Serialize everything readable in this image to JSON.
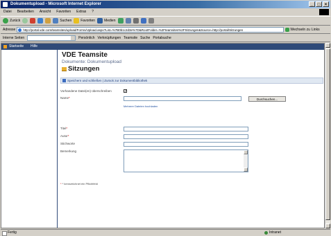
{
  "window": {
    "title": "Dokumentupload - Microsoft Internet Explorer",
    "controls": [
      "_",
      "□",
      "×"
    ]
  },
  "menubar": [
    "Datei",
    "Bearbeiten",
    "Ansicht",
    "Favoriten",
    "Extras",
    "?"
  ],
  "toolbar": {
    "back": "Zurück",
    "forward": "",
    "search": "Suchen",
    "favorites": "Favoriten",
    "media": "Medien"
  },
  "addressbar": {
    "label": "Adresse",
    "url": "http://portal.vde.com/teamsites/upload/Forms/Upload.aspx?List=%7B0b1c2d3e%7D&RootFolder=%2Fteamsites%2FSitzungen&Source=http://portal/Sitzungen",
    "go": "Wechseln zu",
    "links": "Links"
  },
  "linksbar": {
    "label": "Interne Seiten",
    "items": [
      "Persönlich",
      "Verknüpfungen",
      "Teamsite",
      "Suche",
      "Portalsuche"
    ]
  },
  "sharepoint": {
    "site_label": "Startseite",
    "help_label": "Hilfe"
  },
  "page": {
    "site_title": "VDE Teamsite",
    "breadcrumb": "Dokumente: Dokumentupload",
    "title": "Sitzungen",
    "actionbar": "Speichern und schließen  |  Zurück zur Dokumentbibliothek"
  },
  "form": {
    "overwrite_label": "Vorhandene Datei(en) überschreiben",
    "overwrite_checked": true,
    "name_label": "Name",
    "browse_button": "Durchsuchen...",
    "upload_multiple_link": "Mehrere Dateien hochladen",
    "title_label": "Titel",
    "autor_label": "Autor",
    "stichworte_label": "Stichworte",
    "bemerkung_label": "Bemerkung",
    "footnote": "* kennzeichnet ein Pflichtfeld"
  },
  "status": {
    "left": "Fertig",
    "zone": "Intranet"
  }
}
